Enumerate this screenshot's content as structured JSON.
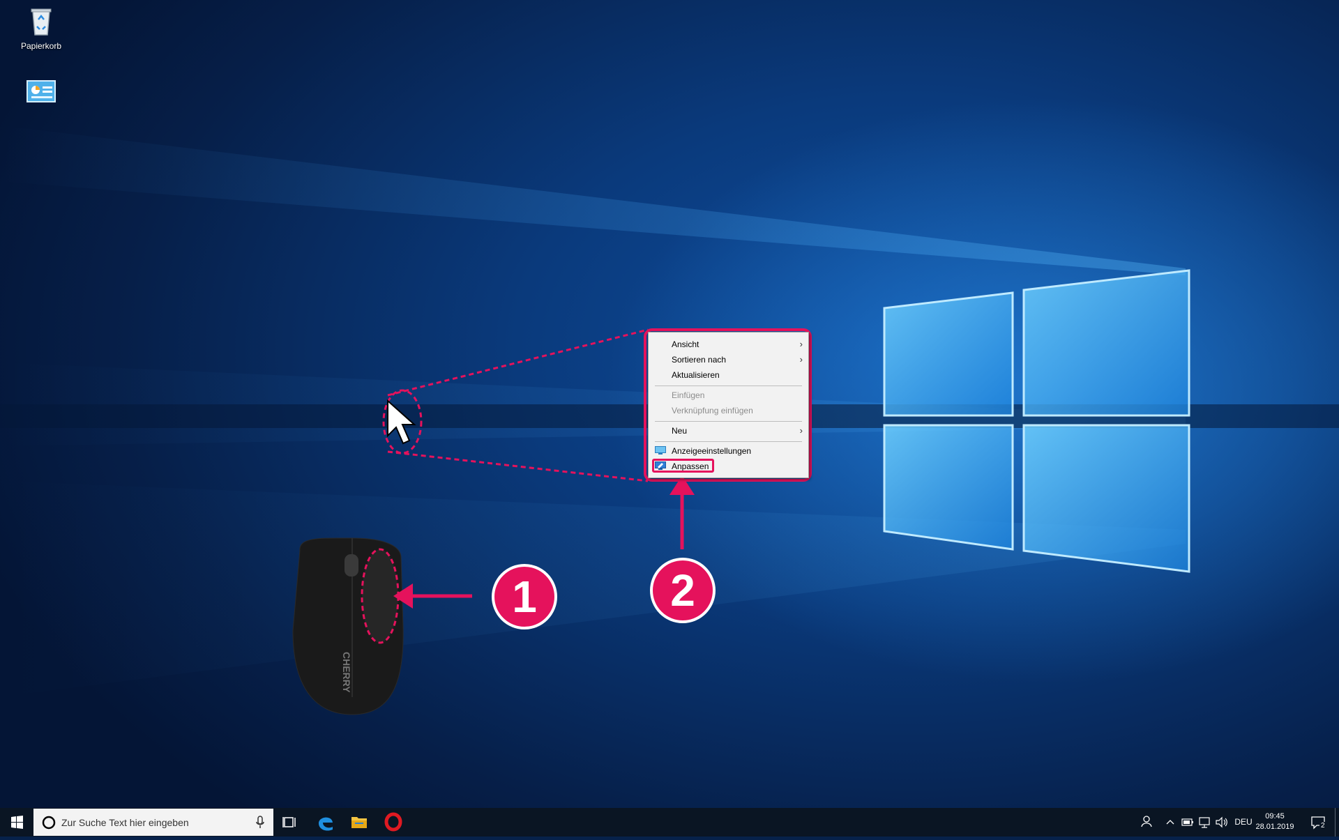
{
  "desktop": {
    "icons": [
      {
        "label": "Papierkorb",
        "icon": "recycle-bin-icon"
      },
      {
        "label": "",
        "icon": "control-panel-icon"
      }
    ]
  },
  "context_menu": {
    "items": [
      {
        "label": "Ansicht",
        "submenu": true
      },
      {
        "label": "Sortieren nach",
        "submenu": true
      },
      {
        "label": "Aktualisieren"
      },
      {
        "label": "Einfügen",
        "disabled": true
      },
      {
        "label": "Verknüpfung einfügen",
        "disabled": true
      },
      {
        "label": "Neu",
        "submenu": true
      },
      {
        "label": "Anzeigeeinstellungen",
        "icon": "display-settings-icon"
      },
      {
        "label": "Anpassen",
        "icon": "personalize-icon",
        "highlighted": true
      }
    ]
  },
  "annotations": {
    "step1": "1",
    "step2": "2",
    "accent_color": "#e5125c",
    "mouse_brand": "CHERRY"
  },
  "taskbar": {
    "search_placeholder": "Zur Suche Text hier eingeben",
    "pinned": [
      "task-view-icon",
      "edge-icon",
      "file-explorer-icon",
      "opera-icon"
    ],
    "tray": {
      "language": "DEU",
      "time": "09:45",
      "date": "28.01.2019",
      "notifications": "2"
    }
  }
}
